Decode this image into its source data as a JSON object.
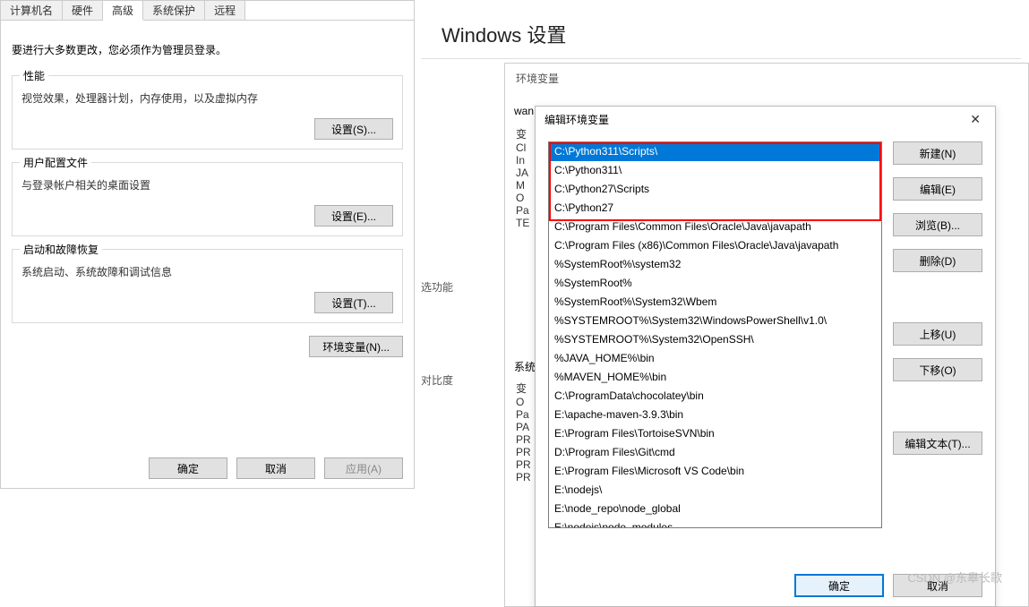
{
  "sysprops": {
    "tabs": [
      "计算机名",
      "硬件",
      "高级",
      "系统保护",
      "远程"
    ],
    "active_tab": 2,
    "note": "要进行大多数更改，您必须作为管理员登录。",
    "perf": {
      "title": "性能",
      "desc": "视觉效果，处理器计划，内存使用，以及虚拟内存",
      "btn": "设置(S)..."
    },
    "profile": {
      "title": "用户配置文件",
      "desc": "与登录帐户相关的桌面设置",
      "btn": "设置(E)..."
    },
    "startup": {
      "title": "启动和故障恢复",
      "desc": "系统启动、系统故障和调试信息",
      "btn": "设置(T)..."
    },
    "env_btn": "环境变量(N)...",
    "footer": {
      "ok": "确定",
      "cancel": "取消",
      "apply": "应用(A)"
    }
  },
  "windows_settings_title": "Windows 设置",
  "env_behind": {
    "title": "环境变量",
    "user_label": "wan",
    "col1": [
      "变",
      "Cl",
      "In",
      "JA",
      "M",
      "O",
      "Pa",
      "TE"
    ],
    "sys_label": "系统",
    "col2": [
      "变",
      "O",
      "Pa",
      "PA",
      "PR",
      "PR",
      "PR",
      "PR"
    ],
    "side_text1": "选功能",
    "side_text2": "对比度"
  },
  "edit_env": {
    "title": "编辑环境变量",
    "paths": [
      "C:\\Python311\\Scripts\\",
      "C:\\Python311\\",
      "C:\\Python27\\Scripts",
      "C:\\Python27",
      "C:\\Program Files\\Common Files\\Oracle\\Java\\javapath",
      "C:\\Program Files (x86)\\Common Files\\Oracle\\Java\\javapath",
      "%SystemRoot%\\system32",
      "%SystemRoot%",
      "%SystemRoot%\\System32\\Wbem",
      "%SYSTEMROOT%\\System32\\WindowsPowerShell\\v1.0\\",
      "%SYSTEMROOT%\\System32\\OpenSSH\\",
      "%JAVA_HOME%\\bin",
      "%MAVEN_HOME%\\bin",
      "C:\\ProgramData\\chocolatey\\bin",
      "E:\\apache-maven-3.9.3\\bin",
      "E:\\Program Files\\TortoiseSVN\\bin",
      "D:\\Program Files\\Git\\cmd",
      "E:\\Program Files\\Microsoft VS Code\\bin",
      "E:\\nodejs\\",
      "E:\\node_repo\\node_global",
      "E:\\nodejs\\node_modules"
    ],
    "selected": 0,
    "buttons": {
      "new": "新建(N)",
      "edit": "编辑(E)",
      "browse": "浏览(B)...",
      "delete": "删除(D)",
      "up": "上移(U)",
      "down": "下移(O)",
      "edit_text": "编辑文本(T)..."
    },
    "footer": {
      "ok": "确定",
      "cancel": "取消"
    }
  },
  "watermark": "CSDN @东皋长歌"
}
